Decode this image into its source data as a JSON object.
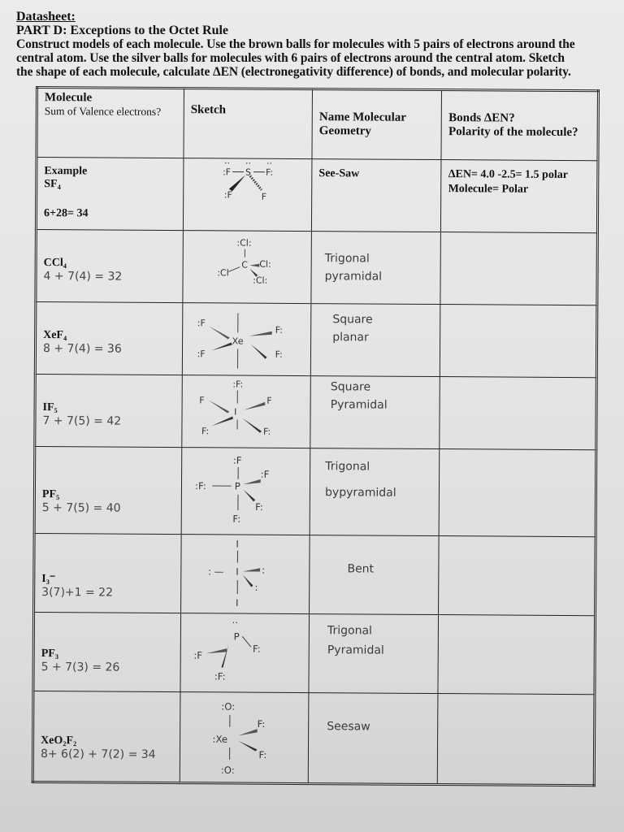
{
  "header": {
    "datasheet": "Datasheet:",
    "part": "PART D: Exceptions to the Octet Rule",
    "instructions_1": "Construct models of each molecule.  Use the brown balls for molecules with 5 pairs of electrons around the",
    "instructions_2": "central atom.  Use the silver balls for molecules with 6 pairs of electrons around the central atom.  Sketch",
    "instructions_3": "the shape of each molecule, calculate ΔEN (electronegativity difference) of bonds, and molecular polarity."
  },
  "table": {
    "columns": {
      "molecule": "Molecule",
      "molecule_sub": "Sum of Valence electrons?",
      "sketch": "Sketch",
      "geometry_1": "Name Molecular",
      "geometry_2": "Geometry",
      "bonds_1": "Bonds ΔEN?",
      "bonds_2": "Polarity of the molecule?"
    },
    "rows": [
      {
        "label": "Example",
        "molecule": "SF₄",
        "valence": "6+28= 34",
        "geometry": "See-Saw",
        "bonds_1": "ΔEN= 4.0 -2.5= 1.5 polar",
        "bonds_2": "Molecule= Polar",
        "sketch": "SF4 see-saw lewis structure"
      },
      {
        "molecule": "CCl₄",
        "valence": "4 + 7(4) = 32",
        "geometry_1": "Trigonal",
        "geometry_2": "pyramidal",
        "bonds": "",
        "sketch": "CCl4 lewis structure"
      },
      {
        "molecule": "XeF₄",
        "valence": "8 + 7(4) = 36",
        "geometry_1": "Square",
        "geometry_2": "planar",
        "bonds": "",
        "sketch": "XeF4 lewis structure"
      },
      {
        "molecule": "IF₅",
        "valence": "7 + 7(5) = 42",
        "geometry_1": "Square",
        "geometry_2": "Pyramidal",
        "bonds": "",
        "sketch": "IF5 lewis structure"
      },
      {
        "molecule": "PF₅",
        "valence": "5 + 7(5) = 40",
        "geometry_1": "Trigonal",
        "geometry_2": "bypyramidal",
        "bonds": "",
        "sketch": "PF5 lewis structure"
      },
      {
        "molecule": "I₃⁻",
        "valence": "3(7)+1 = 22",
        "geometry_1": "Bent",
        "bonds": "",
        "sketch": "I3- lewis structure"
      },
      {
        "molecule": "PF₃",
        "valence": "5 + 7(3) = 26",
        "geometry_1": "Trigonal",
        "geometry_2": "Pyramidal",
        "bonds": "",
        "sketch": "PF3 lewis structure"
      },
      {
        "molecule": "XeO₂F₂",
        "valence": "8+ 6(2) + 7(2) = 34",
        "geometry_1": "Seesaw",
        "bonds": "",
        "sketch": "XeO2F2 lewis structure"
      }
    ]
  },
  "atoms": {
    "S": "S",
    "F": "F",
    "C": "C",
    "Cl": "Cl",
    "Xe": "Xe",
    "I": "I",
    "P": "P",
    "O": "O"
  }
}
